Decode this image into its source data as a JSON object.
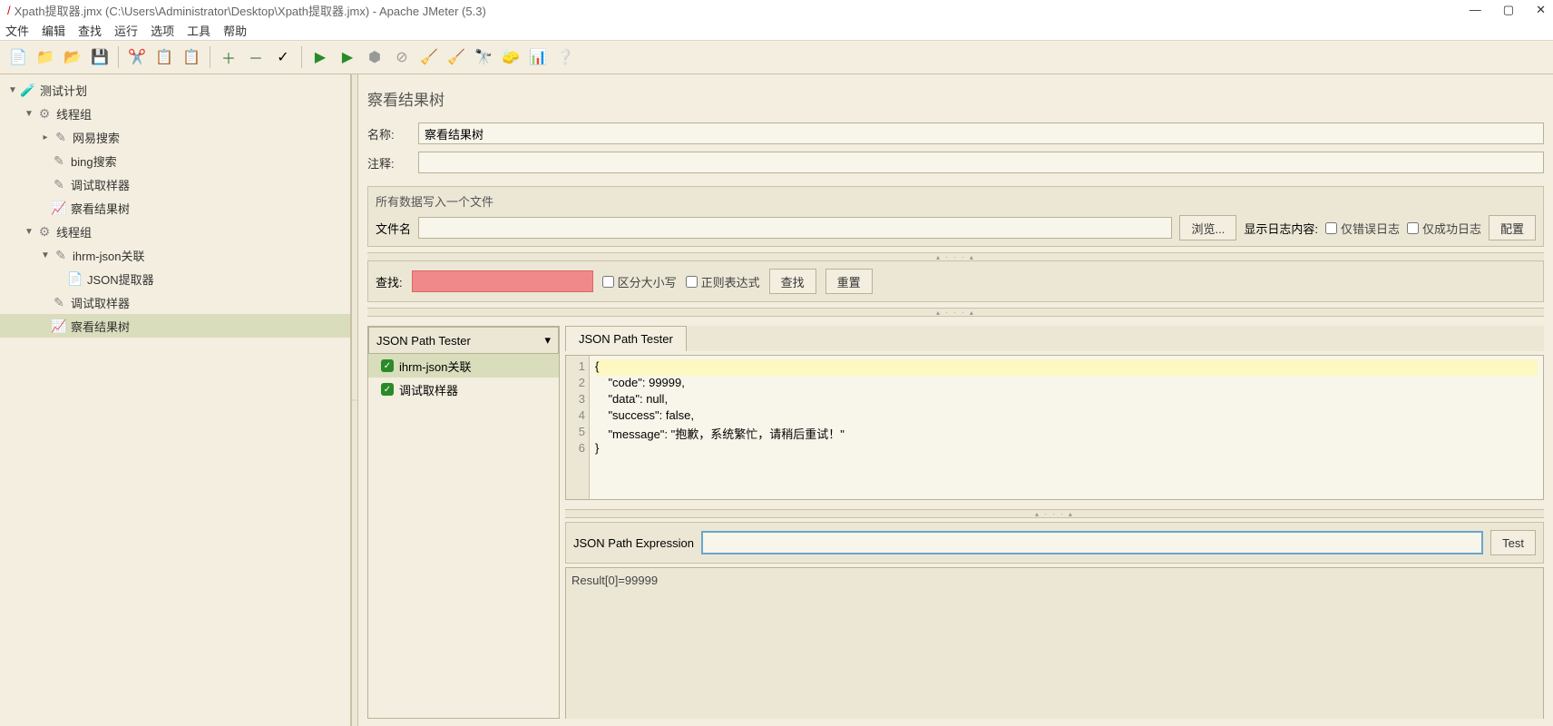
{
  "window_title": "Xpath提取器.jmx (C:\\Users\\Administrator\\Desktop\\Xpath提取器.jmx) - Apache JMeter (5.3)",
  "menu": [
    "文件",
    "编辑",
    "查找",
    "运行",
    "选项",
    "工具",
    "帮助"
  ],
  "tree": {
    "root": "测试计划",
    "g1": "线程组",
    "g1_items": [
      "网易搜索",
      "bing搜索",
      "调试取样器",
      "察看结果树"
    ],
    "g2": "线程组",
    "g2a": "ihrm-json关联",
    "g2a_items": [
      "JSON提取器"
    ],
    "g2_items": [
      "调试取样器",
      "察看结果树"
    ]
  },
  "page": {
    "title": "察看结果树",
    "name_label": "名称:",
    "name_value": "察看结果树",
    "comment_label": "注释:",
    "section_title": "所有数据写入一个文件",
    "filename_label": "文件名",
    "browse": "浏览...",
    "show_log_label": "显示日志内容:",
    "only_error": "仅错误日志",
    "only_success": "仅成功日志",
    "config": "配置",
    "search_label": "查找:",
    "case": "区分大小写",
    "regex": "正则表达式",
    "search_btn": "查找",
    "reset_btn": "重置",
    "dropdown": "JSON Path Tester",
    "result_items": [
      "ihrm-json关联",
      "调试取样器"
    ],
    "tab": "JSON Path Tester",
    "code_lines": [
      "{",
      "    \"code\": 99999,",
      "    \"data\": null,",
      "    \"success\": false,",
      "    \"message\": \"抱歉，系统繁忙，请稍后重试！\"",
      "}"
    ],
    "expr_label": "JSON Path Expression",
    "test_btn": "Test",
    "result_text": "Result[0]=99999"
  }
}
